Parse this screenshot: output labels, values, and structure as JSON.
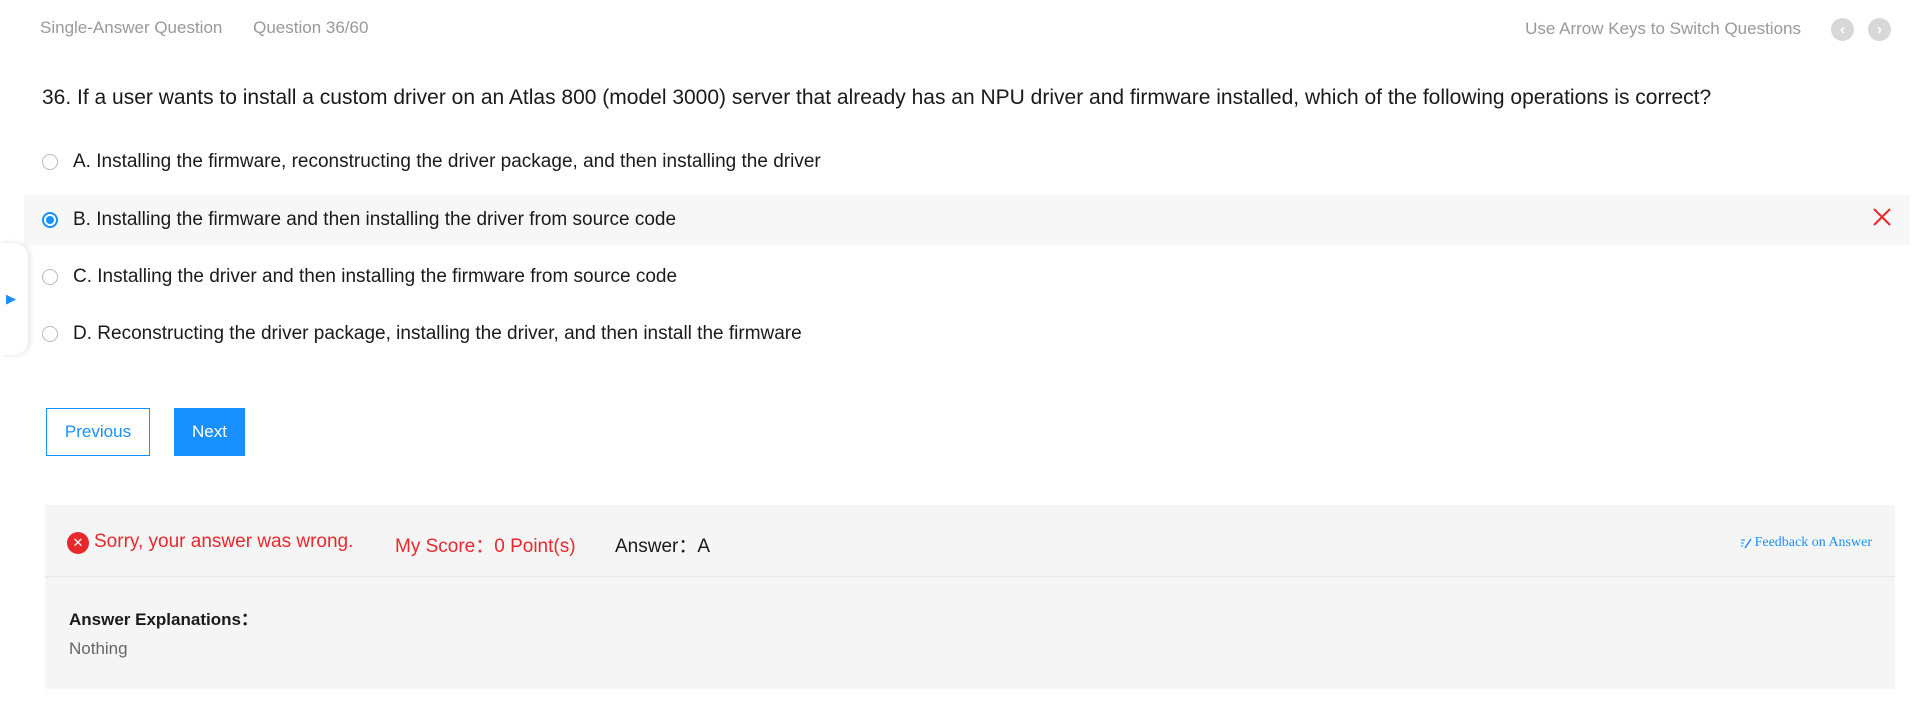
{
  "header": {
    "question_type": "Single-Answer Question",
    "progress": "Question 36/60",
    "hint": "Use Arrow Keys to Switch Questions",
    "prev_icon": "‹",
    "next_icon": "›"
  },
  "question": {
    "text": "36. If a user wants to install a custom driver on an Atlas 800 (model 3000) server that already has an NPU driver and firmware installed, which of the following operations is correct?",
    "options": [
      {
        "label": "A. Installing the firmware, reconstructing the driver package, and then installing the driver",
        "selected": false
      },
      {
        "label": "B. Installing the firmware and then installing the driver from source code",
        "selected": true,
        "marked_wrong": true
      },
      {
        "label": "C. Installing the driver and then installing the firmware from source code",
        "selected": false
      },
      {
        "label": "D. Reconstructing the driver package, installing the driver, and then install the firmware",
        "selected": false
      }
    ]
  },
  "side_tab": {
    "icon": "▶"
  },
  "buttons": {
    "previous": "Previous",
    "next": "Next"
  },
  "result": {
    "status_icon": "✕",
    "status_text": "Sorry, your answer was wrong.",
    "score_text": "My Score：0 Point(s)",
    "answer_text": "Answer：A",
    "feedback_text": "Feedback on Answer",
    "explanation_label": "Answer Explanations：",
    "explanation_text": "Nothing"
  },
  "colors": {
    "accent": "#1890ff",
    "error": "#e8282d",
    "muted": "#999999",
    "panel_bg": "#f5f5f5",
    "selected_row_bg": "#f7f7f7"
  }
}
